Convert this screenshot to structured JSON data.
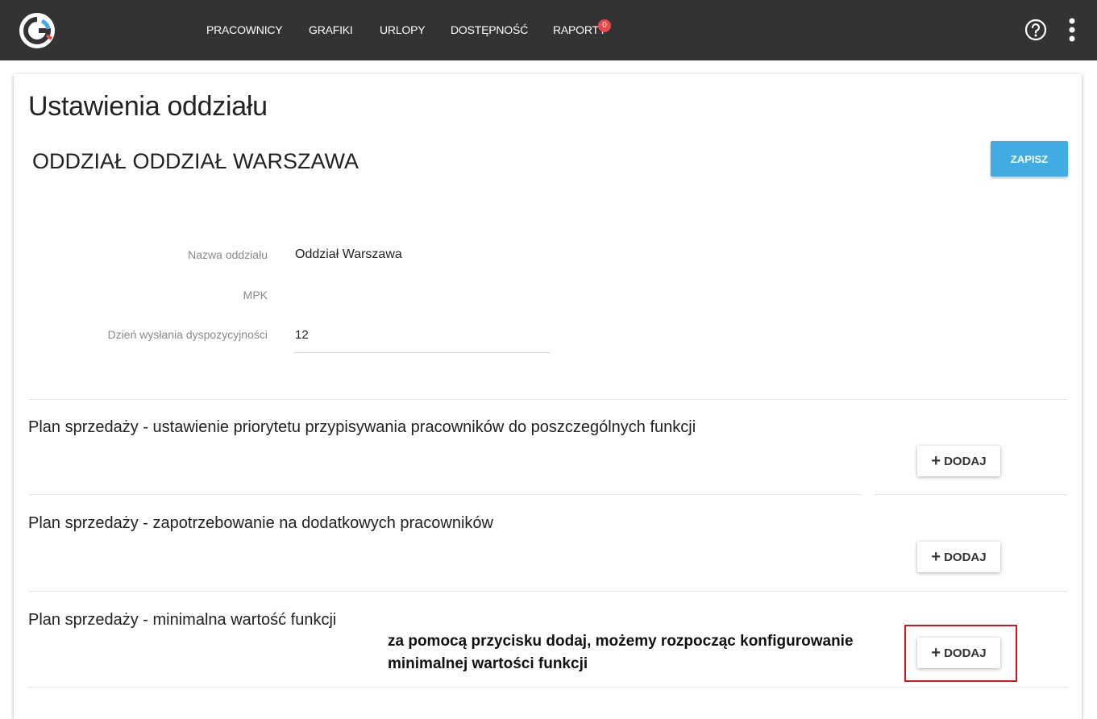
{
  "nav": {
    "items": [
      {
        "label": "PRACOWNICY"
      },
      {
        "label": "GRAFIKI"
      },
      {
        "label": "URLOPY"
      },
      {
        "label": "DOSTĘPNOŚĆ"
      },
      {
        "label": "RAPORTY",
        "badge": "0"
      }
    ]
  },
  "page": {
    "title": "Ustawienia oddziału",
    "branch_title": "ODDZIAŁ ODDZIAŁ WARSZAWA",
    "save_label": "ZAPISZ"
  },
  "fields": [
    {
      "label": "Nazwa oddziału",
      "value": "Oddział Warszawa"
    },
    {
      "label": "MPK",
      "value": ""
    },
    {
      "label": "Dzień wysłania dyspozycyjności",
      "value": "12"
    }
  ],
  "sections": [
    {
      "title": "Plan sprzedaży - ustawienie priorytetu przypisywania pracowników do poszczególnych funkcji",
      "button": "DODAJ"
    },
    {
      "title": "Plan sprzedaży - zapotrzebowanie na dodatkowych pracowników",
      "button": "DODAJ"
    },
    {
      "title": "Plan sprzedaży - minimalna wartość funkcji",
      "button": "DODAJ"
    }
  ],
  "annotation": {
    "text": "za pomocą przycisku dodaj, możemy rozpocząc konfigurowanie minimalnej wartości funkcji"
  },
  "colors": {
    "topbar": "#333333",
    "accent": "#41ace2",
    "badge": "#e84a4a",
    "highlight": "#d0151b"
  }
}
